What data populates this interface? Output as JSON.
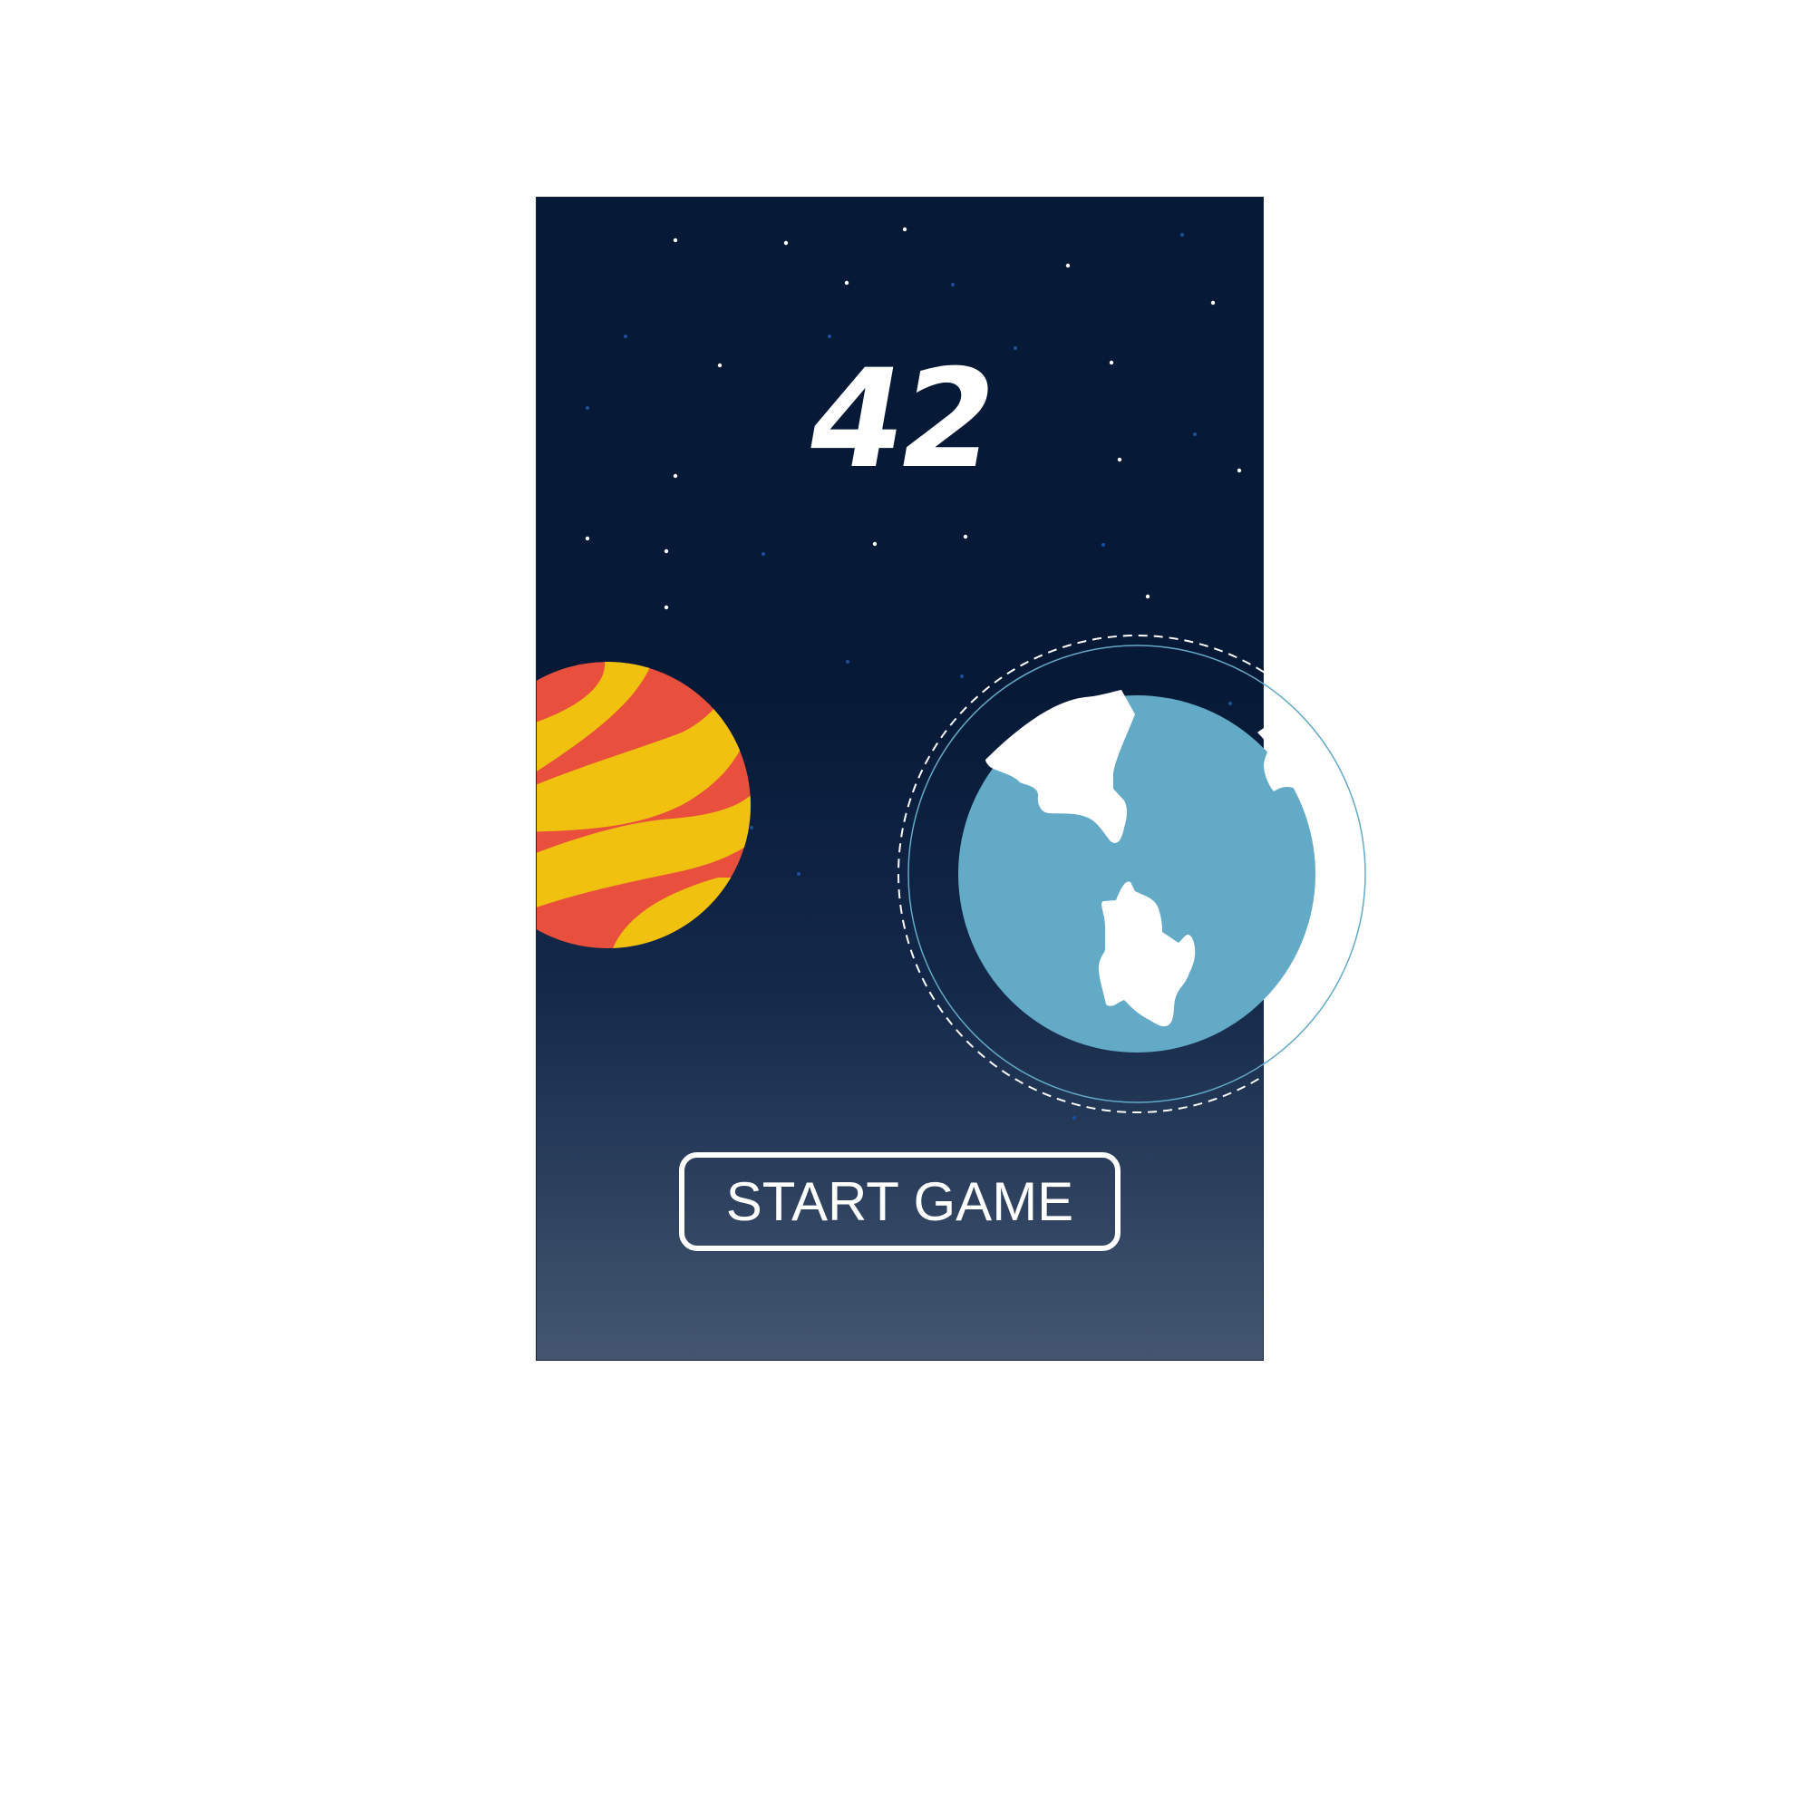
{
  "game": {
    "score": "42",
    "start_button_label": "START GAME"
  },
  "colors": {
    "space_background": "#061936",
    "space_bottom": "#44566f",
    "planet_red": "#e84f3d",
    "planet_yellow": "#f0c20f",
    "earth_ocean": "#63aac7",
    "earth_land": "#ffffff",
    "orbit_ring": "#63aac7",
    "star_white": "#ffffff",
    "star_blue": "#1e4f9e"
  },
  "icons": {
    "striped_planet": "striped-planet-icon",
    "earth": "earth-icon",
    "star": "star-icon"
  }
}
